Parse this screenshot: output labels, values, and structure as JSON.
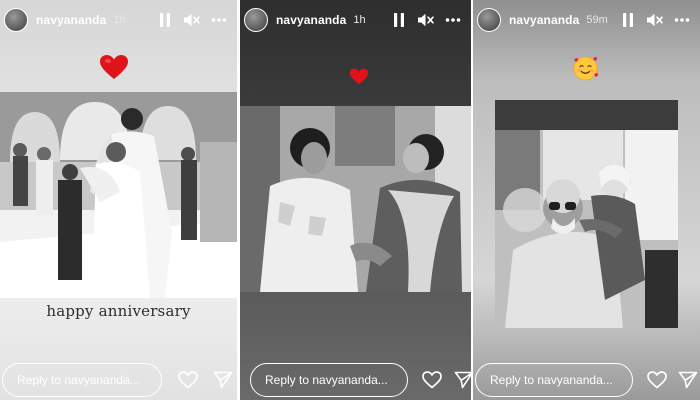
{
  "stories": [
    {
      "username": "navyananda",
      "time": "1h",
      "emoji": "❤️",
      "caption": "happy anniversary",
      "reply_placeholder": "Reply to navyananda..."
    },
    {
      "username": "navyananda",
      "time": "1h",
      "emoji": "❤️",
      "reply_placeholder": "Reply to navyananda..."
    },
    {
      "username": "navyananda",
      "time": "59m",
      "emoji": "🥰",
      "reply_placeholder": "Reply to navyananda..."
    }
  ],
  "icons": {
    "pause": "pause-icon",
    "mute": "mute-icon",
    "more": "more-options-icon",
    "like": "heart-icon",
    "share": "send-icon"
  },
  "colors": {
    "heart_red": "#e0131b",
    "text_white": "#ffffff",
    "caption_text": "#2d2d2d"
  }
}
